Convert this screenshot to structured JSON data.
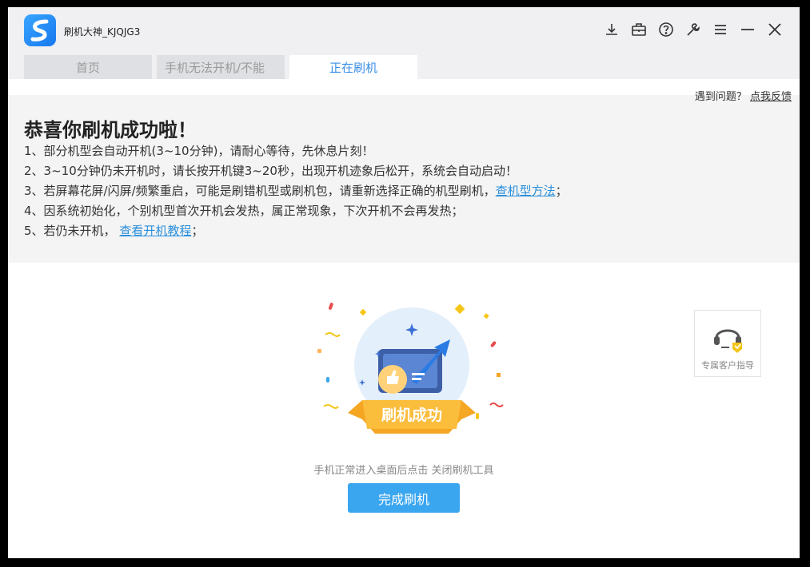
{
  "app": {
    "title": "刷机大神_KJQJG3"
  },
  "toolbar": {
    "icons": [
      "download-icon",
      "toolbox-icon",
      "help-icon",
      "wrench-icon",
      "menu-icon",
      "minimize-icon",
      "close-icon"
    ]
  },
  "tabs": [
    {
      "label": "首页"
    },
    {
      "label": "手机无法开机/不能"
    },
    {
      "label": "正在刷机"
    }
  ],
  "feedback": {
    "question": "遇到问题？",
    "link": "点我反馈"
  },
  "result": {
    "headline": "恭喜你刷机成功啦！",
    "tips": [
      {
        "text": "1、部分机型会自动开机(3~10分钟)，请耐心等待，先休息片刻！"
      },
      {
        "text": "2、3~10分钟仍未开机时，请长按开机键3~20秒，出现开机迹象后松开，系统会自动启动！"
      },
      {
        "text": "3、若屏幕花屏/闪屏/频繁重启，可能是刷错机型或刷机包，请重新选择正确的机型刷机，",
        "link": "查机型方法",
        "suffix": "；"
      },
      {
        "text": "4、因系统初始化，个别机型首次开机会发热，属正常现象，下次开机不会再发热；"
      },
      {
        "text": "5、若仍未开机，",
        "link": "查看开机教程",
        "suffix": "；"
      }
    ]
  },
  "banner": {
    "text": "刷机成功"
  },
  "service": {
    "label": "专属客户指导"
  },
  "hint": "手机正常进入桌面后点击 关闭刷机工具",
  "done_button": "完成刷机",
  "colors": {
    "accent": "#3aa6f0",
    "link": "#2b8fdb",
    "banner": "#f5a623"
  }
}
